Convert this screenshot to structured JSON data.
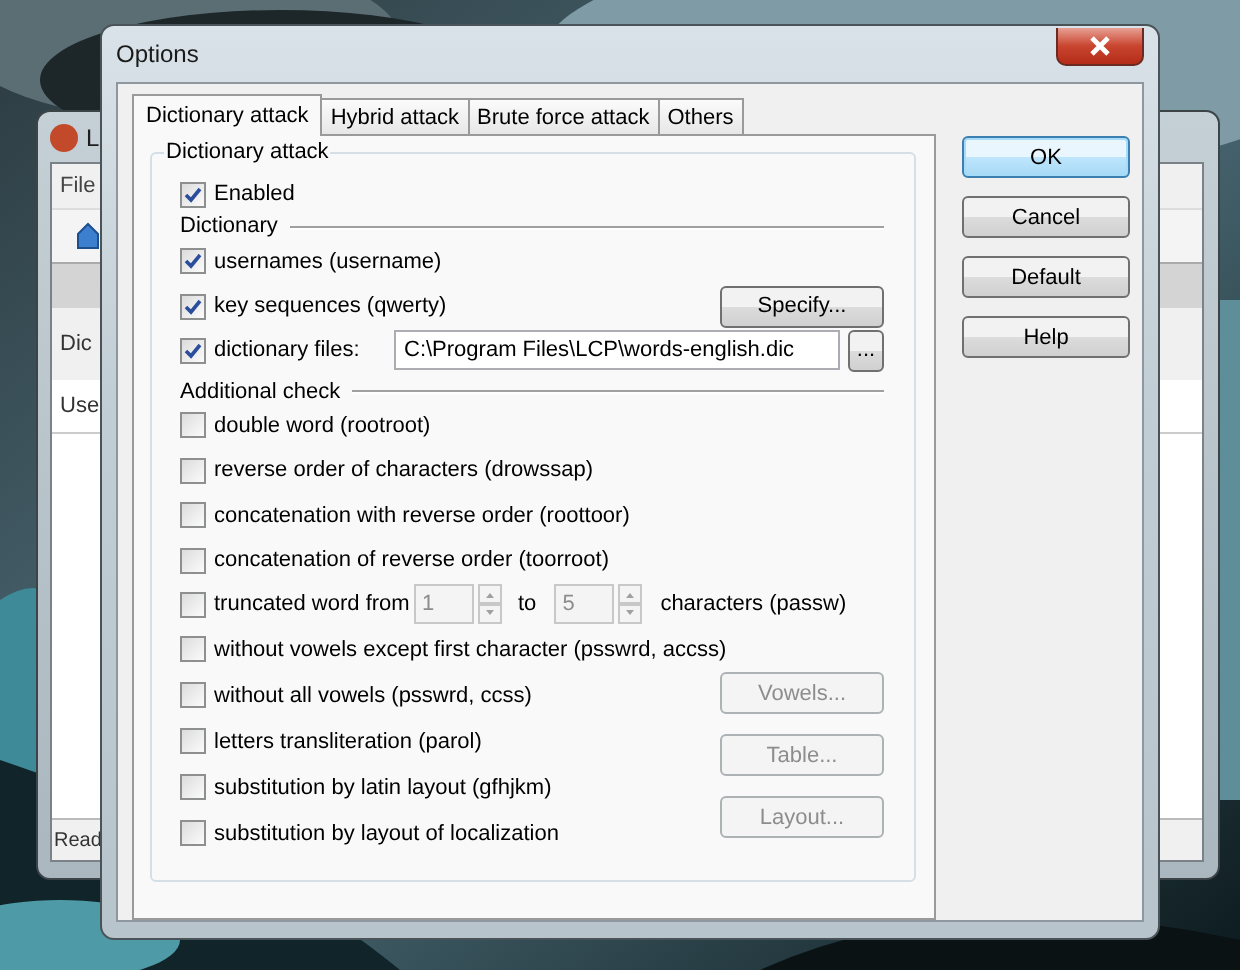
{
  "background_window": {
    "title": "L",
    "menu": [
      "File"
    ],
    "labels": [
      "Dic",
      "Use"
    ],
    "status": "Read"
  },
  "dialog": {
    "title": "Options",
    "tabs": [
      {
        "label": "Dictionary attack",
        "selected": true
      },
      {
        "label": "Hybrid attack",
        "selected": false
      },
      {
        "label": "Brute force attack",
        "selected": false
      },
      {
        "label": "Others",
        "selected": false
      }
    ],
    "group": {
      "title": "Dictionary attack",
      "enabled": {
        "label": "Enabled",
        "checked": true
      },
      "sections": [
        {
          "title": "Dictionary",
          "items": [
            {
              "kind": "check",
              "label": "usernames (username)",
              "checked": true
            },
            {
              "kind": "check_button",
              "label": "key sequences (qwerty)",
              "checked": true,
              "button": "Specify...",
              "button_disabled": false
            },
            {
              "kind": "check_file",
              "label": "dictionary files:",
              "checked": true,
              "value": "C:\\Program Files\\LCP\\words-english.dic",
              "browse": "..."
            }
          ]
        },
        {
          "title": "Additional check",
          "items": [
            {
              "kind": "check",
              "label": "double word (rootroot)",
              "checked": false
            },
            {
              "kind": "check",
              "label": "reverse order of characters (drowssap)",
              "checked": false
            },
            {
              "kind": "check",
              "label": "concatenation with reverse order (roottoor)",
              "checked": false
            },
            {
              "kind": "check",
              "label": "concatenation of reverse order (toorroot)",
              "checked": false
            },
            {
              "kind": "range",
              "label": "truncated word from",
              "checked": false,
              "from": "1",
              "to_label": "to",
              "to": "5",
              "suffix": "characters (passw)",
              "disabled": true
            },
            {
              "kind": "check",
              "label": "without vowels except first character (psswrd, accss)",
              "checked": false
            }
          ],
          "lower_items": [
            {
              "kind": "check",
              "label": "without all vowels (psswrd, ccss)",
              "checked": false
            },
            {
              "kind": "check",
              "label": "letters transliteration (parol)",
              "checked": false
            },
            {
              "kind": "check",
              "label": "substitution by latin layout (gfhjkm)",
              "checked": false
            },
            {
              "kind": "check",
              "label": "substitution by layout of localization",
              "checked": false
            }
          ],
          "buttons": [
            {
              "label": "Vowels...",
              "disabled": true
            },
            {
              "label": "Table...",
              "disabled": true
            },
            {
              "label": "Layout...",
              "disabled": true
            }
          ]
        }
      ]
    },
    "buttons": [
      {
        "label": "OK",
        "default": true
      },
      {
        "label": "Cancel",
        "default": false
      },
      {
        "label": "Default",
        "default": false
      },
      {
        "label": "Help",
        "default": false
      }
    ]
  }
}
